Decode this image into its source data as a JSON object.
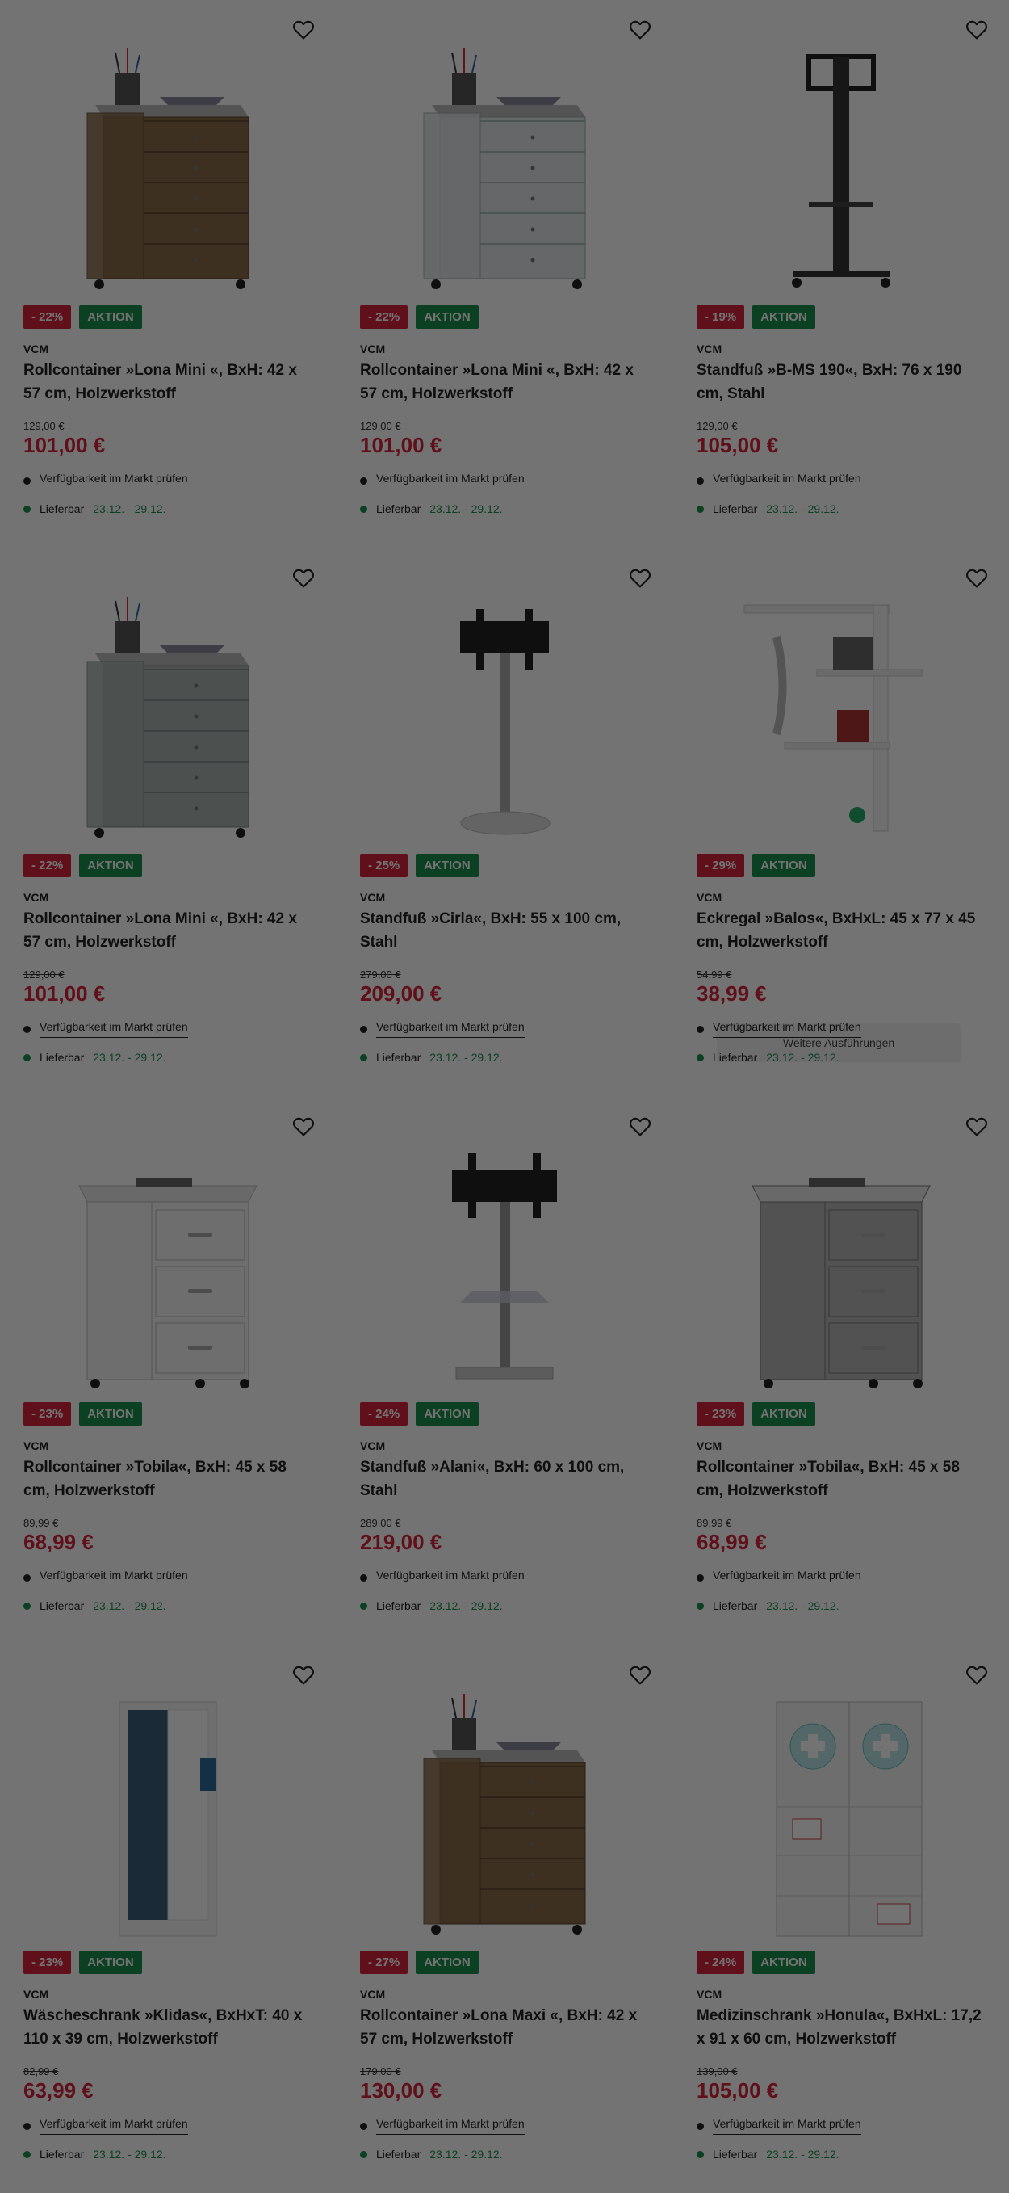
{
  "products": [
    {
      "badge_discount": "- 22%",
      "badge_action": "AKTION",
      "brand": "VCM",
      "title": "Rollcontainer »Lona Mini «, BxH: 42 x 57 cm, Holzwerkstoff",
      "old_price": "129,00 €",
      "price": "101,00 €",
      "availability": "Verfügbarkeit im Markt prüfen",
      "delivery_label": "Lieferbar",
      "delivery_dates": "23.12. - 29.12.",
      "image": "drawer-wood"
    },
    {
      "badge_discount": "- 22%",
      "badge_action": "AKTION",
      "brand": "VCM",
      "title": "Rollcontainer »Lona Mini «, BxH: 42 x 57 cm, Holzwerkstoff",
      "old_price": "129,00 €",
      "price": "101,00 €",
      "availability": "Verfügbarkeit im Markt prüfen",
      "delivery_label": "Lieferbar",
      "delivery_dates": "23.12. - 29.12.",
      "image": "drawer-white"
    },
    {
      "badge_discount": "- 19%",
      "badge_action": "AKTION",
      "brand": "VCM",
      "title": "Standfuß »B-MS 190«, BxH: 76 x 190 cm, Stahl",
      "old_price": "129,00 €",
      "price": "105,00 €",
      "availability": "Verfügbarkeit im Markt prüfen",
      "delivery_label": "Lieferbar",
      "delivery_dates": "23.12. - 29.12.",
      "image": "tv-stand-tall"
    },
    {
      "badge_discount": "- 22%",
      "badge_action": "AKTION",
      "brand": "VCM",
      "title": "Rollcontainer »Lona Mini «, BxH: 42 x 57 cm, Holzwerkstoff",
      "old_price": "129,00 €",
      "price": "101,00 €",
      "availability": "Verfügbarkeit im Markt prüfen",
      "delivery_label": "Lieferbar",
      "delivery_dates": "23.12. - 29.12.",
      "image": "drawer-grey"
    },
    {
      "badge_discount": "- 25%",
      "badge_action": "AKTION",
      "brand": "VCM",
      "title": "Standfuß »Cirla«, BxH: 55 x 100 cm, Stahl",
      "old_price": "279,00 €",
      "price": "209,00 €",
      "availability": "Verfügbarkeit im Markt prüfen",
      "delivery_label": "Lieferbar",
      "delivery_dates": "23.12. - 29.12.",
      "image": "tv-stand-round"
    },
    {
      "badge_discount": "- 29%",
      "badge_action": "AKTION",
      "brand": "VCM",
      "title": "Eckregal »Balos«, BxHxL: 45 x 77 x 45 cm, Holzwerkstoff",
      "old_price": "54,99 €",
      "price": "38,99 €",
      "availability": "Verfügbarkeit im Markt prüfen",
      "delivery_label": "Lieferbar",
      "delivery_dates": "23.12. - 29.12.",
      "image": "corner-shelf",
      "variants_label": "Weitere Ausführungen"
    },
    {
      "badge_discount": "- 23%",
      "badge_action": "AKTION",
      "brand": "VCM",
      "title": "Rollcontainer »Tobila«, BxH: 45 x 58 cm, Holzwerkstoff",
      "old_price": "89,99 €",
      "price": "68,99 €",
      "availability": "Verfügbarkeit im Markt prüfen",
      "delivery_label": "Lieferbar",
      "delivery_dates": "23.12. - 29.12.",
      "image": "drawer-white-3"
    },
    {
      "badge_discount": "- 24%",
      "badge_action": "AKTION",
      "brand": "VCM",
      "title": "Standfuß »Alani«, BxH: 60 x 100 cm, Stahl",
      "old_price": "289,00 €",
      "price": "219,00 €",
      "availability": "Verfügbarkeit im Markt prüfen",
      "delivery_label": "Lieferbar",
      "delivery_dates": "23.12. - 29.12.",
      "image": "tv-stand-glass"
    },
    {
      "badge_discount": "- 23%",
      "badge_action": "AKTION",
      "brand": "VCM",
      "title": "Rollcontainer »Tobila«, BxH: 45 x 58 cm, Holzwerkstoff",
      "old_price": "89,99 €",
      "price": "68,99 €",
      "availability": "Verfügbarkeit im Markt prüfen",
      "delivery_label": "Lieferbar",
      "delivery_dates": "23.12. - 29.12.",
      "image": "drawer-grey-3"
    },
    {
      "badge_discount": "- 23%",
      "badge_action": "AKTION",
      "brand": "VCM",
      "title": "Wäscheschrank »Klidas«, BxHxT: 40 x 110 x 39 cm, Holzwerkstoff",
      "old_price": "82,99 €",
      "price": "63,99 €",
      "availability": "Verfügbarkeit im Markt prüfen",
      "delivery_label": "Lieferbar",
      "delivery_dates": "23.12. - 29.12.",
      "image": "laundry-cabinet"
    },
    {
      "badge_discount": "- 27%",
      "badge_action": "AKTION",
      "brand": "VCM",
      "title": "Rollcontainer »Lona Maxi «, BxH: 42 x 57 cm, Holzwerkstoff",
      "old_price": "179,00 €",
      "price": "130,00 €",
      "availability": "Verfügbarkeit im Markt prüfen",
      "delivery_label": "Lieferbar",
      "delivery_dates": "23.12. - 29.12.",
      "image": "drawer-wood-maxi"
    },
    {
      "badge_discount": "- 24%",
      "badge_action": "AKTION",
      "brand": "VCM",
      "title": "Medizinschrank »Honula«, BxHxL: 17,2 x 91 x 60 cm, Holzwerkstoff",
      "old_price": "139,00 €",
      "price": "105,00 €",
      "availability": "Verfügbarkeit im Markt prüfen",
      "delivery_label": "Lieferbar",
      "delivery_dates": "23.12. - 29.12.",
      "image": "medicine-cabinet"
    }
  ],
  "colors": {
    "discount": "#d6243a",
    "action": "#1a8e4c",
    "price": "#d6243a",
    "overlay": "rgba(0,0,0,0.55)"
  }
}
